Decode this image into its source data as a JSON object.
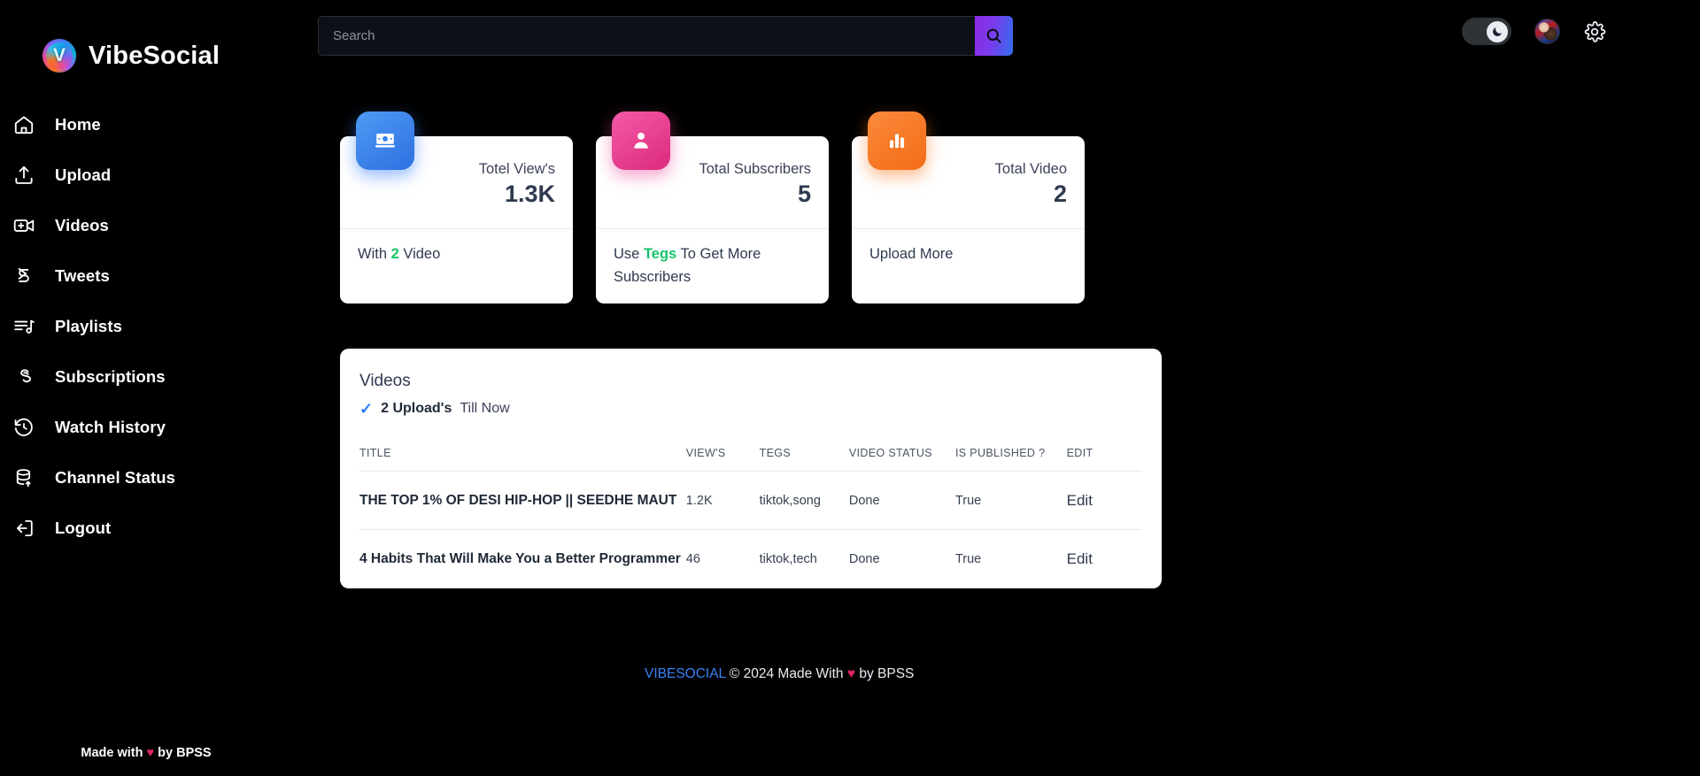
{
  "brand": {
    "name": "VibeSocial",
    "logo_icon": "vibesocial-logo"
  },
  "sidebar": {
    "items": [
      {
        "label": "Home",
        "icon": "home-icon"
      },
      {
        "label": "Upload",
        "icon": "upload-icon"
      },
      {
        "label": "Videos",
        "icon": "video-camera-icon"
      },
      {
        "label": "Tweets",
        "icon": "tweets-icon"
      },
      {
        "label": "Playlists",
        "icon": "playlist-music-icon"
      },
      {
        "label": "Subscriptions",
        "icon": "subscriptions-icon"
      },
      {
        "label": "Watch History",
        "icon": "history-clock-icon"
      },
      {
        "label": "Channel Status",
        "icon": "database-upload-icon"
      },
      {
        "label": "Logout",
        "icon": "logout-icon"
      }
    ],
    "footer": {
      "prefix": "Made with",
      "heart": "♥",
      "suffix": "by BPSS"
    }
  },
  "header": {
    "search": {
      "value": "",
      "placeholder": "Search",
      "button_icon": "search-icon"
    },
    "theme_toggle": {
      "icon": "moon-icon",
      "state": "dark"
    },
    "avatar": "user-avatar",
    "settings_icon": "gear-icon"
  },
  "stats": [
    {
      "label": "Totel View's",
      "value": "1.3K",
      "icon": "monitor-views-icon",
      "accent": "#3b82f6",
      "footer_prefix": "With",
      "footer_highlight": "2",
      "footer_suffix": "Video"
    },
    {
      "label": "Total Subscribers",
      "value": "5",
      "icon": "user-icon",
      "accent": "#ec4899",
      "footer_prefix": "Use",
      "footer_highlight": "Tegs",
      "footer_suffix": "To Get More Subscribers"
    },
    {
      "label": "Total Video",
      "value": "2",
      "icon": "bar-chart-icon",
      "accent": "#f97316",
      "footer_prefix": "Upload More",
      "footer_highlight": "",
      "footer_suffix": ""
    }
  ],
  "videos_panel": {
    "title": "Videos",
    "check_icon": "check-icon",
    "uploads_count": "2 Upload's",
    "uploads_suffix": "Till Now",
    "columns": [
      "TITLE",
      "VIEW'S",
      "TEGS",
      "VIDEO STATUS",
      "IS PUBLISHED ?",
      "EDIT"
    ],
    "rows": [
      {
        "title": "THE TOP 1% OF DESI HIP-HOP || SEEDHE MAUT",
        "views": "1.2K",
        "tegs": "tiktok,song",
        "status": "Done",
        "published": "True",
        "edit": "Edit"
      },
      {
        "title": "4 Habits That Will Make You a Better Programmer",
        "views": "46",
        "tegs": "tiktok,tech",
        "status": "Done",
        "published": "True",
        "edit": "Edit"
      }
    ]
  },
  "page_footer": {
    "brand": "VIBESOCIAL",
    "copyright": "© 2024 Made With",
    "heart": "♥",
    "by": "by BPSS"
  }
}
